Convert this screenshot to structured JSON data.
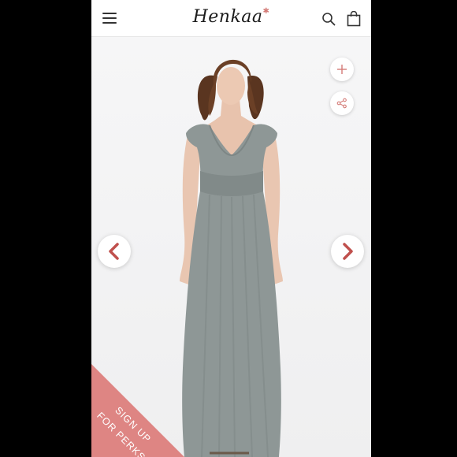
{
  "header": {
    "logo_text": "Henkaa",
    "menu_icon": "hamburger-menu-icon",
    "search_icon": "search-icon",
    "bag_icon": "shopping-bag-icon"
  },
  "product_viewer": {
    "zoom_icon": "plus-icon",
    "share_icon": "share-icon",
    "prev_icon": "chevron-left-icon",
    "next_icon": "chevron-right-icon"
  },
  "promo": {
    "line1": "SIGN UP",
    "line2": "FOR PERKS"
  },
  "colors": {
    "accent": "#d47b77",
    "arrow": "#c0504d",
    "dress": "#8e9796",
    "background": "#000000"
  }
}
